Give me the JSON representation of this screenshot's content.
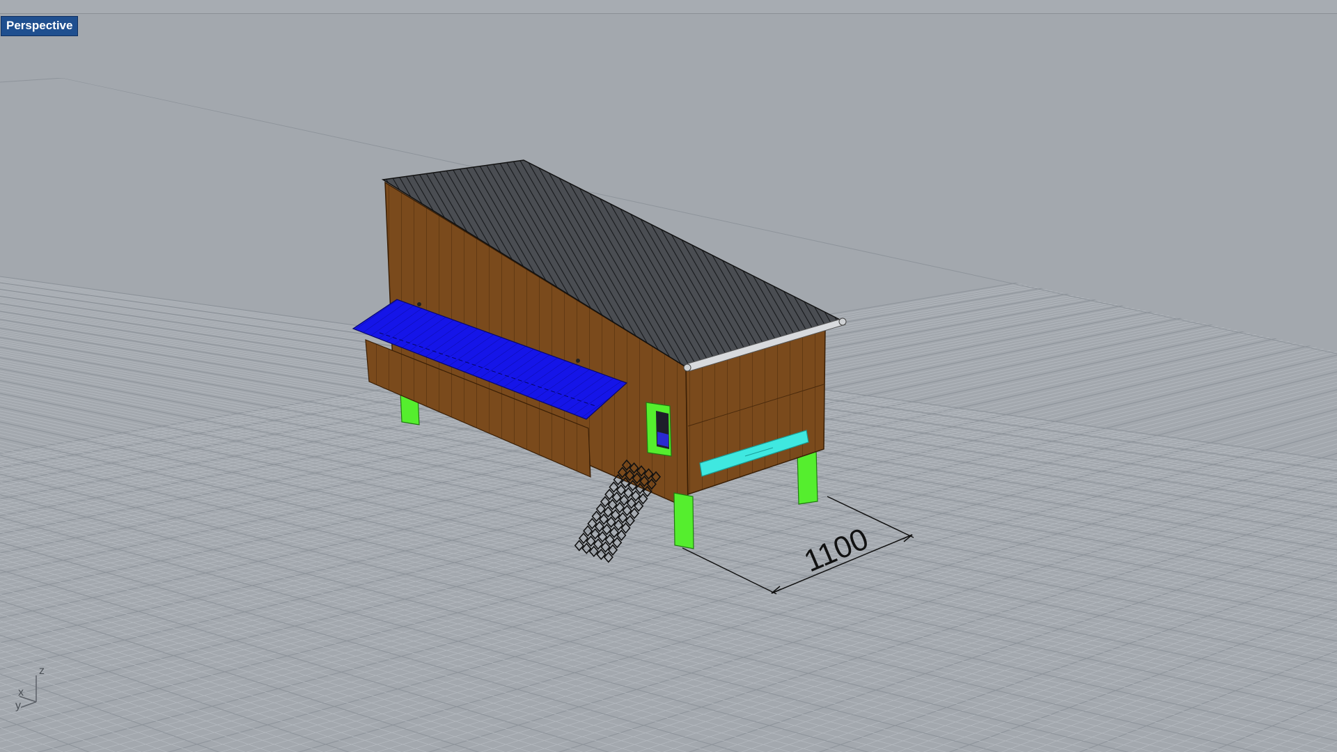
{
  "viewport": {
    "name": "Perspective"
  },
  "dimension": {
    "value": "1100"
  },
  "axes": {
    "x": "x",
    "y": "y",
    "z": "z"
  },
  "colors": {
    "background": "#a3a8ae",
    "grid_minor": "#b6bbc1",
    "grid_major": "#8e949b",
    "wall": "#7a4a1c",
    "wall_dark": "#5e3713",
    "roof": "#3b3e42",
    "awning": "#1414e6",
    "legs": "#55ee2e",
    "vent": "#3fe8e0",
    "viewport_tab": "#1f4f8f"
  },
  "icons": {
    "axis_widget": "world-axes-icon"
  }
}
